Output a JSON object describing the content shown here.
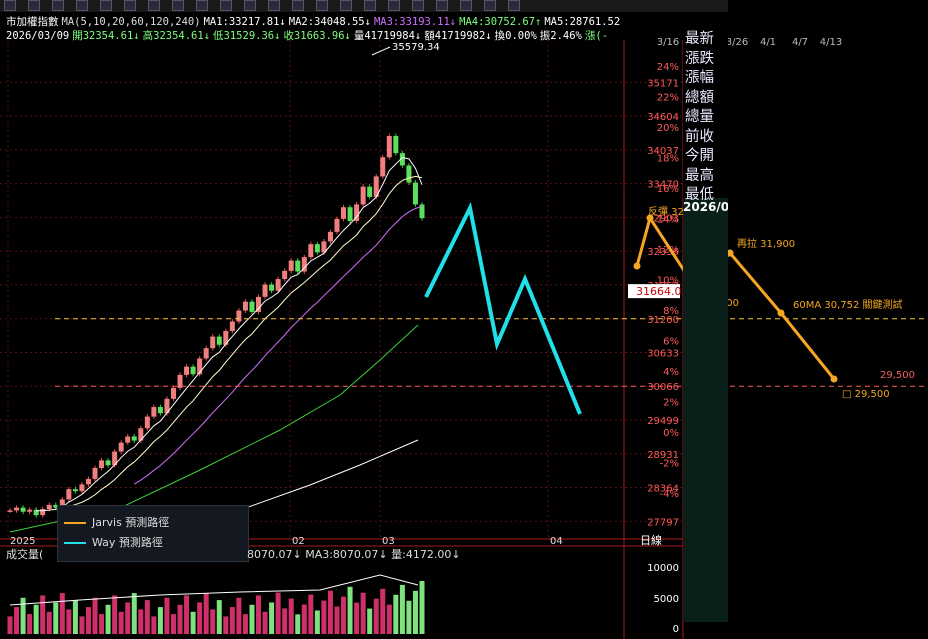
{
  "header": {
    "index_name": "市加權指數",
    "ma_row": [
      {
        "text": "MA(5,10,20,60,120,240)",
        "color": "#dddddd"
      },
      {
        "text": "MA1:33217.81↓",
        "color": "#ffffff"
      },
      {
        "text": "MA2:34048.55↓",
        "color": "#ffffff"
      },
      {
        "text": "MA3:33193.11↓",
        "color": "#d070ff"
      },
      {
        "text": "MA4:30752.67↑",
        "color": "#7dff7d"
      },
      {
        "text": "MA5:28761.52",
        "color": "#ffffff"
      }
    ],
    "quote_row": [
      {
        "text": "2026/03/09",
        "color": "#ffffff"
      },
      {
        "text": "開32354.61↓",
        "color": "#7dff7d"
      },
      {
        "text": "高32354.61↓",
        "color": "#7dff7d"
      },
      {
        "text": "低31529.36↓",
        "color": "#7dff7d"
      },
      {
        "text": "收31663.96↓",
        "color": "#7dff7d"
      },
      {
        "text": "量41719984↓",
        "color": "#ffffff"
      },
      {
        "text": "額41719982↓",
        "color": "#ffffff"
      },
      {
        "text": "換0.00%",
        "color": "#ffffff"
      },
      {
        "text": "振2.46%",
        "color": "#ffffff"
      },
      {
        "text": "漲(-",
        "color": "#7dff7d"
      }
    ]
  },
  "right_panel": {
    "labels": [
      "最新",
      "漲跌",
      "漲幅",
      "總額",
      "總量",
      "前收",
      "今開",
      "最高",
      "最低"
    ],
    "date": "2026/0"
  },
  "volume": {
    "label": "成交量(",
    "ma_text": "8070.07↓ MA3:8070.07↓ 量:4172.00↓"
  },
  "legend": {
    "items": [
      {
        "name": "Jarvis 預測路徑",
        "color": "#f5a623"
      },
      {
        "name": "Way 預測路徑",
        "color": "#22e0e8"
      }
    ]
  },
  "chart_data": [
    {
      "type": "candlestick",
      "title": "市加權指數",
      "x_labels": [
        "2025",
        "02",
        "03",
        "04"
      ],
      "y_ticks": [
        "35171",
        "34604",
        "34037",
        "33470",
        "32903",
        "32336",
        "31769",
        "31200",
        "30633",
        "30066",
        "29499",
        "28931",
        "28364",
        "27797"
      ],
      "pct_ticks": [
        "24%",
        "22%",
        "20%",
        "18%",
        "16%",
        "14%",
        "12%",
        "10%",
        "8%",
        "6%",
        "4%",
        "2%",
        "0%",
        "-2%",
        "-4%"
      ],
      "ylim": [
        27600,
        35800
      ],
      "high_marker": "35579.34",
      "last_price": "31664.0",
      "reference_lines": [
        {
          "value": 31200,
          "color": "#f5c542"
        },
        {
          "value": 30066,
          "color": "#ff5a5a"
        }
      ],
      "grid": true
    },
    {
      "type": "line",
      "series": [
        {
          "name": "Jarvis 預測路徑",
          "color": "#f5a623",
          "points": [
            {
              "label": "",
              "value": 31650
            },
            {
              "label": "反彈 32,900",
              "value": 32900
            },
            {
              "label": "31,200",
              "value": 31250
            },
            {
              "label": "再拉 31,900",
              "value": 31900
            },
            {
              "label": "60MA 30,752 關鍵測試",
              "value": 31150
            },
            {
              "label": "□ 29,500",
              "value": 29500
            }
          ]
        },
        {
          "name": "Way 預測路徑",
          "color": "#22e0e8",
          "points": [
            {
              "value": 31050
            },
            {
              "value": 31400
            },
            {
              "value": 30450
            },
            {
              "value": 31200
            },
            {
              "value": 29100
            }
          ]
        }
      ],
      "x_labels": [
        "3/16",
        "3/26",
        "4/1",
        "4/7",
        "4/13"
      ],
      "annotations": [
        "60MA 30,752",
        "關鍵測試",
        "29,500"
      ]
    },
    {
      "type": "bar",
      "title": "成交量",
      "y_ticks": [
        "10000",
        "5000",
        "0"
      ],
      "axis_label": "日線"
    }
  ]
}
